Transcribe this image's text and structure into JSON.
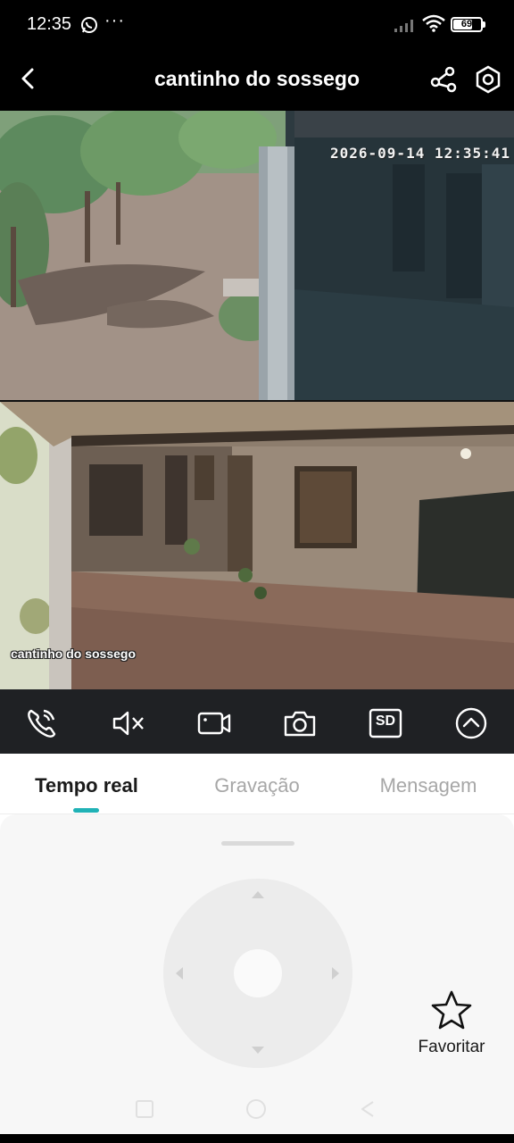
{
  "status_bar": {
    "time": "12:35",
    "more_indicator": "···",
    "battery_level": 69,
    "battery_text": "69",
    "icons": [
      "whatsapp-icon",
      "signal-icon",
      "wifi-icon",
      "battery-icon"
    ]
  },
  "header": {
    "title": "cantinho do sossego",
    "icons": [
      "back-icon",
      "share-icon",
      "settings-icon"
    ]
  },
  "video": {
    "timestamp": "2026-09-14 12:35:41",
    "camera_label": "cantinho do sossego"
  },
  "controls": {
    "sd_label": "SD",
    "icons": [
      "intercom-icon",
      "mute-icon",
      "record-icon",
      "snapshot-icon",
      "sd-icon",
      "expand-up-icon"
    ]
  },
  "tabs": [
    {
      "label": "Tempo real",
      "active": true
    },
    {
      "label": "Gravação",
      "active": false
    },
    {
      "label": "Mensagem",
      "active": false
    }
  ],
  "ptz": {
    "arrows": [
      "up",
      "down",
      "left",
      "right"
    ]
  },
  "favorite": {
    "label": "Favoritar",
    "icon": "star-icon"
  },
  "nav_bar": {
    "icons": [
      "recents-icon",
      "home-icon",
      "back-nav-icon"
    ]
  },
  "colors": {
    "accent": "#20b2b6",
    "control_bar": "#1f2124",
    "tab_active": "#1a1a1a",
    "tab_inactive": "#a7a7a7"
  }
}
